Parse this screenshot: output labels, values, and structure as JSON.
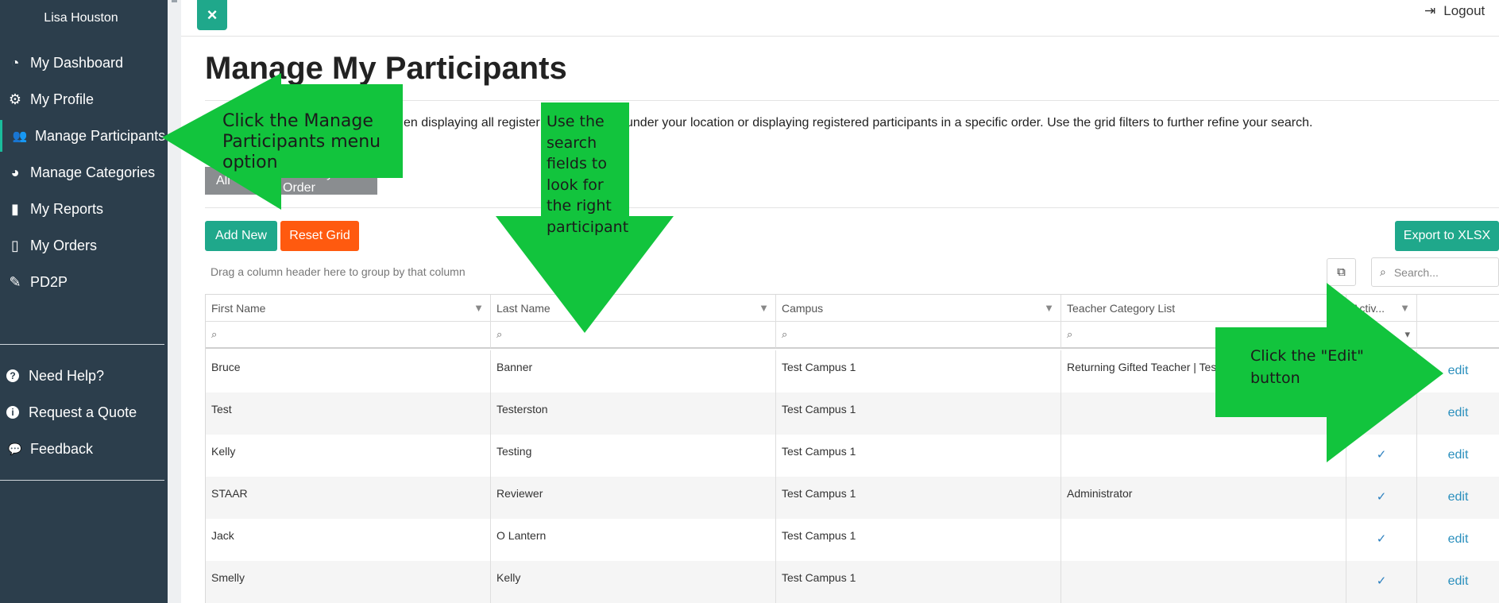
{
  "sidebar": {
    "user_name": "Lisa Houston",
    "nav": [
      {
        "label": "My Dashboard",
        "icon": "dashboard-icon",
        "glyph": "◔"
      },
      {
        "label": "My Profile",
        "icon": "gears-icon",
        "glyph": "⚙"
      },
      {
        "label": "Manage Participants",
        "icon": "users-icon",
        "glyph": "👥"
      },
      {
        "label": "Manage Categories",
        "icon": "pie-chart-icon",
        "glyph": "◕"
      },
      {
        "label": "My Reports",
        "icon": "bar-chart-icon",
        "glyph": "▮"
      },
      {
        "label": "My Orders",
        "icon": "file-icon",
        "glyph": "▯"
      },
      {
        "label": "PD2P",
        "icon": "pencil-icon",
        "glyph": "✎"
      }
    ],
    "help": [
      {
        "label": "Need Help?",
        "icon": "question-circle-icon",
        "glyph": "?"
      },
      {
        "label": "Request a Quote",
        "icon": "info-circle-icon",
        "glyph": "i"
      },
      {
        "label": "Feedback",
        "icon": "comments-icon",
        "glyph": "💬"
      }
    ]
  },
  "header": {
    "close_glyph": "×",
    "logout_label": "Logout",
    "logout_glyph": "⇥"
  },
  "page": {
    "title": "Manage My Participants",
    "description_visible": "en displaying all register",
    "description_visible_2": "under your location or displaying registered participants in a specific order. Use the grid filters to further refine your search.",
    "tabs": [
      "All",
      "Users by Order"
    ]
  },
  "toolbar": {
    "add_new": "Add New",
    "reset_grid": "Reset Grid",
    "export": "Export to XLSX",
    "drag_hint": "Drag a column header here to group by that column",
    "search_placeholder": "Search...",
    "search_glyph": "⌕",
    "column_chooser_glyph": "⧉"
  },
  "grid": {
    "columns": [
      "First Name",
      "Last Name",
      "Campus",
      "Teacher Category List",
      "Activ...",
      ""
    ],
    "filter_glyph": "⌕",
    "rows": [
      {
        "first": "Bruce",
        "last": "Banner",
        "campus": "Test Campus 1",
        "category": "Returning Gifted Teacher | Test",
        "active": "",
        "action": "edit"
      },
      {
        "first": "Test",
        "last": "Testerston",
        "campus": "Test Campus 1",
        "category": "",
        "active": "",
        "action": "edit"
      },
      {
        "first": "Kelly",
        "last": "Testing",
        "campus": "Test Campus 1",
        "category": "",
        "active": "✓",
        "action": "edit"
      },
      {
        "first": "STAAR",
        "last": "Reviewer",
        "campus": "Test Campus 1",
        "category": "Administrator",
        "active": "✓",
        "action": "edit"
      },
      {
        "first": "Jack",
        "last": "O Lantern",
        "campus": "Test Campus 1",
        "category": "",
        "active": "✓",
        "action": "edit"
      },
      {
        "first": "Smelly",
        "last": "Kelly",
        "campus": "Test Campus 1",
        "category": "",
        "active": "✓",
        "action": "edit"
      }
    ]
  },
  "annotations": {
    "menu_text": "Click the Manage Participants menu option",
    "search_text": "Use the search fields to look for the right participant",
    "edit_text": "Click the \"Edit\" button",
    "arrow_color": "#12c43d"
  },
  "colors": {
    "sidebar": "#2c3e4c",
    "teal": "#1fa88b",
    "orange": "#ff5a0f",
    "link": "#2a8fbd"
  }
}
